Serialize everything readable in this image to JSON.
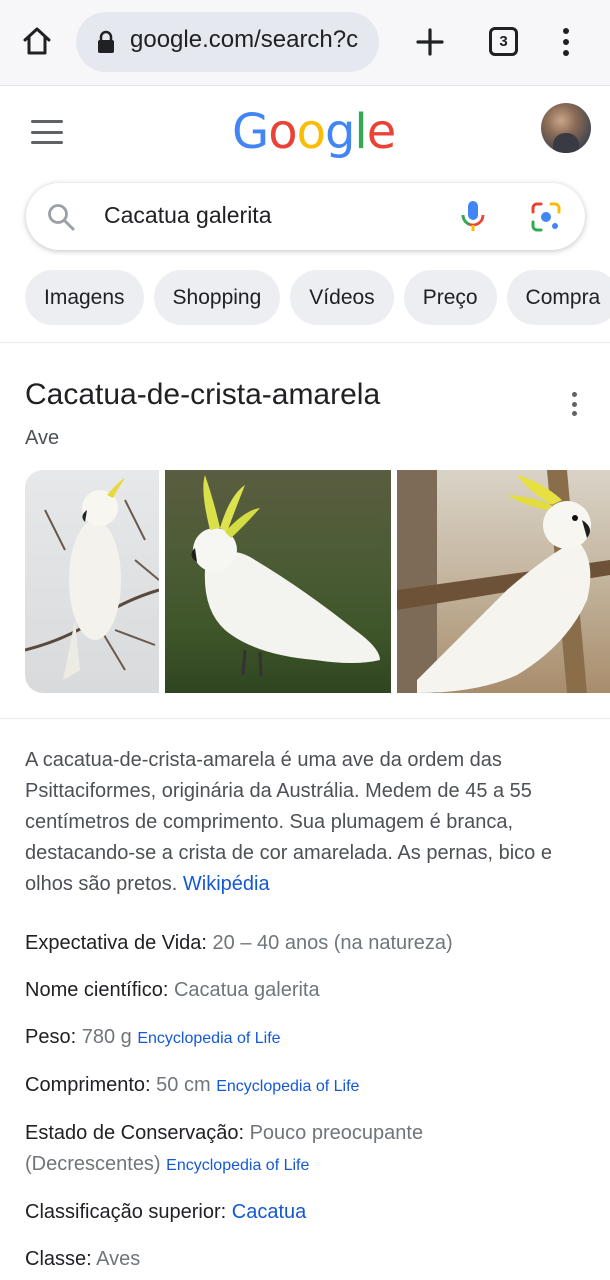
{
  "browser": {
    "url": "google.com/search?c",
    "tab_count": "3"
  },
  "google": {
    "logo": "Google"
  },
  "search": {
    "query": "Cacatua galerita"
  },
  "chips": [
    "Imagens",
    "Shopping",
    "Vídeos",
    "Preço",
    "Compra"
  ],
  "panel": {
    "title": "Cacatua-de-crista-amarela",
    "subtitle": "Ave",
    "description": "A cacatua-de-crista-amarela é uma ave da ordem das Psittaciformes, originária da Austrália. Medem de 45 a 55 centímetros de comprimento. Sua plumagem é branca, destacando-se a crista de cor amarelada. As pernas, bico e olhos são pretos.",
    "description_source": "Wikipédia",
    "facts": [
      {
        "label": "Expectativa de Vida:",
        "value": "20 – 40 anos (na natureza)",
        "source": ""
      },
      {
        "label": "Nome científico:",
        "value": "Cacatua galerita",
        "source": ""
      },
      {
        "label": "Peso:",
        "value": "780 g",
        "source": "Encyclopedia of Life"
      },
      {
        "label": "Comprimento:",
        "value": "50 cm",
        "source": "Encyclopedia of Life"
      },
      {
        "label": "Estado de Conservação:",
        "value": "Pouco preocupante",
        "value_line2": "(Decrescentes)",
        "source": "Encyclopedia of Life"
      },
      {
        "label": "Classificação superior:",
        "value": "Cacatua",
        "source": ""
      },
      {
        "label": "Classe:",
        "value": "Aves",
        "source": ""
      }
    ]
  },
  "colors": {
    "link": "#1558d6",
    "google_blue": "#4285F4",
    "google_red": "#EA4335",
    "google_yellow": "#FBBC05",
    "google_green": "#34A853"
  }
}
